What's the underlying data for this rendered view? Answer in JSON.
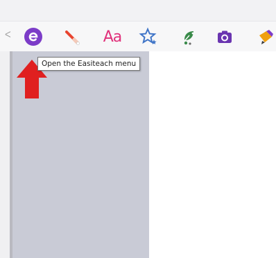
{
  "toolbar": {
    "collapse_glyph": "ᐸ",
    "tools": [
      {
        "icon": "easiteach-e-icon",
        "glyph": "e",
        "color": "#7c3cc8"
      },
      {
        "icon": "pen-icon",
        "color": "#e8442f"
      },
      {
        "icon": "text-aa-icon",
        "glyph": "Aa",
        "color": "#e0307a"
      },
      {
        "icon": "star-shapes-icon",
        "color": "#3f74c7"
      },
      {
        "icon": "eraser-leaf-icon",
        "color": "#3a8a4a"
      },
      {
        "icon": "camera-icon",
        "color": "#6a35b0"
      },
      {
        "icon": "highlighter-icon",
        "color": "#f0a010"
      }
    ]
  },
  "tooltip": {
    "text": "Open the Easiteach menu"
  },
  "annotation": {
    "arrow_color": "#e02020"
  },
  "colors": {
    "sidebar": "#c9cbd6",
    "toolbar": "#f7f7f8"
  }
}
